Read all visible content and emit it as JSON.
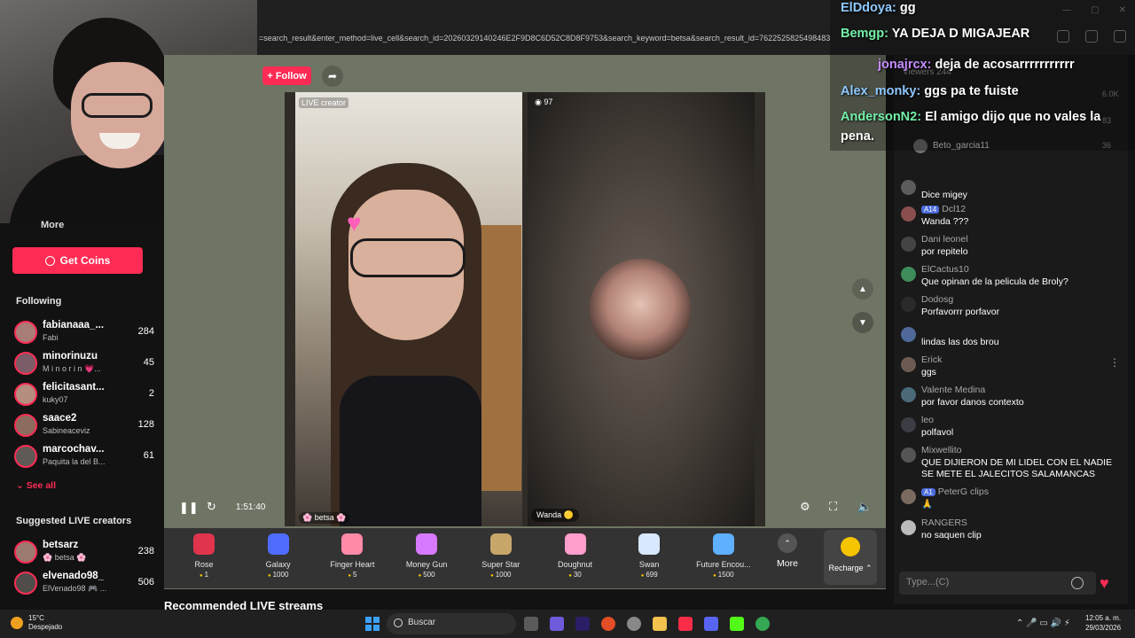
{
  "browser": {
    "url": "=search_result&enter_method=live_cell&search_id=20260329140246E2F9D8C6D52C8D8F9753&search_keyword=betsa&search_result_id=7622525825498483"
  },
  "sidebar": {
    "more_label": "More",
    "get_coins": "Get Coins",
    "following_title": "Following",
    "following": [
      {
        "name": "fabianaaa_...",
        "sub": "Fabi",
        "count": "284"
      },
      {
        "name": "minorinuzu",
        "sub": "M i n o r i n 💗...",
        "count": "45"
      },
      {
        "name": "felicitasant...",
        "sub": "kuky07",
        "count": "2"
      },
      {
        "name": "saace2",
        "sub": "Sabineaceviz",
        "count": "128"
      },
      {
        "name": "marcochav...",
        "sub": "Paquita la del B...",
        "count": "61"
      }
    ],
    "see_all": "See all",
    "suggested_title": "Suggested LIVE creators",
    "suggested": [
      {
        "name": "betsarz",
        "sub": "🌸 betsa 🌸",
        "count": "238"
      },
      {
        "name": "elvenado98_",
        "sub": "ElVenado98 🎮 ...",
        "count": "506"
      }
    ]
  },
  "stage": {
    "follow": "+ Follow",
    "live_creator": "LIVE creator",
    "viewer_badge": "97",
    "host_name": "🌸 betsa 🌸",
    "guest_name": "Wanda 🟡",
    "timer": "1:51:40"
  },
  "gifts": [
    {
      "name": "Rose",
      "price": "1",
      "color": "#e0344c"
    },
    {
      "name": "Galaxy",
      "price": "1000",
      "color": "#4f6cff"
    },
    {
      "name": "Finger Heart",
      "price": "5",
      "color": "#ff8aa8"
    },
    {
      "name": "Money Gun",
      "price": "500",
      "color": "#d77aff"
    },
    {
      "name": "Super Star",
      "price": "1000",
      "color": "#c7a66a"
    },
    {
      "name": "Doughnut",
      "price": "30",
      "color": "#ff9ecb"
    },
    {
      "name": "Swan",
      "price": "699",
      "color": "#d8e8ff"
    },
    {
      "name": "Future Encou...",
      "price": "1500",
      "color": "#5fb0ff"
    }
  ],
  "more_gifts": "More",
  "recharge": "Recharge ⌃",
  "recommended_title": "Recommended LIVE streams",
  "chat": {
    "viewers_label": "Viewers",
    "viewers_count": "244",
    "top_counts": [
      "6.0K",
      "83",
      "36"
    ],
    "top_viewer": "Beto_garcia11",
    "messages": [
      {
        "user": "",
        "text": "Dice migey"
      },
      {
        "user": "Dcl12",
        "level": "14",
        "text": "Wanda ???"
      },
      {
        "user": "Dani leonel",
        "text": "por repitelo"
      },
      {
        "user": "ElCactus10",
        "text": "Que opinan de la pelicula de Broly?"
      },
      {
        "user": "Dodosg",
        "text": "Porfavorrr porfavor"
      },
      {
        "user": "",
        "text": "lindas las dos brou"
      },
      {
        "user": "Erick",
        "text": "ggs"
      },
      {
        "user": "Valente Medina",
        "text": "por favor danos contexto"
      },
      {
        "user": "leo",
        "text": "polfavol"
      },
      {
        "user": "Mixwellito",
        "text": "QUE DIJIERON DE MI LIDEL CON EL NADIE SE METE EL JALECITOS SALAMANCAS"
      },
      {
        "user": "PeterG clips",
        "level": "1",
        "text": "🙏"
      },
      {
        "user": "RANGERS",
        "text": "no saquen clip"
      }
    ],
    "input_placeholder": "Type...(C)"
  },
  "overlay": {
    "lines": [
      {
        "user": "ElDdoya:",
        "text": " gg"
      },
      {
        "user": "Bemgp:",
        "text": " YA DEJA D MIGAJEAR"
      },
      {
        "user": "jonajrcx:",
        "text": " deja de acosarrrrrrrrrrr"
      },
      {
        "user": "Alex_monky:",
        "text": " ggs pa te fuiste"
      },
      {
        "user": "AndersonN2:",
        "text": " El amigo dijo que no vales la"
      },
      {
        "user": "",
        "text": "pena."
      }
    ]
  },
  "taskbar": {
    "temp": "15°C",
    "weather": "Despejado",
    "search": "Buscar",
    "time": "12:05 a. m.",
    "date": "29/03/2026"
  }
}
